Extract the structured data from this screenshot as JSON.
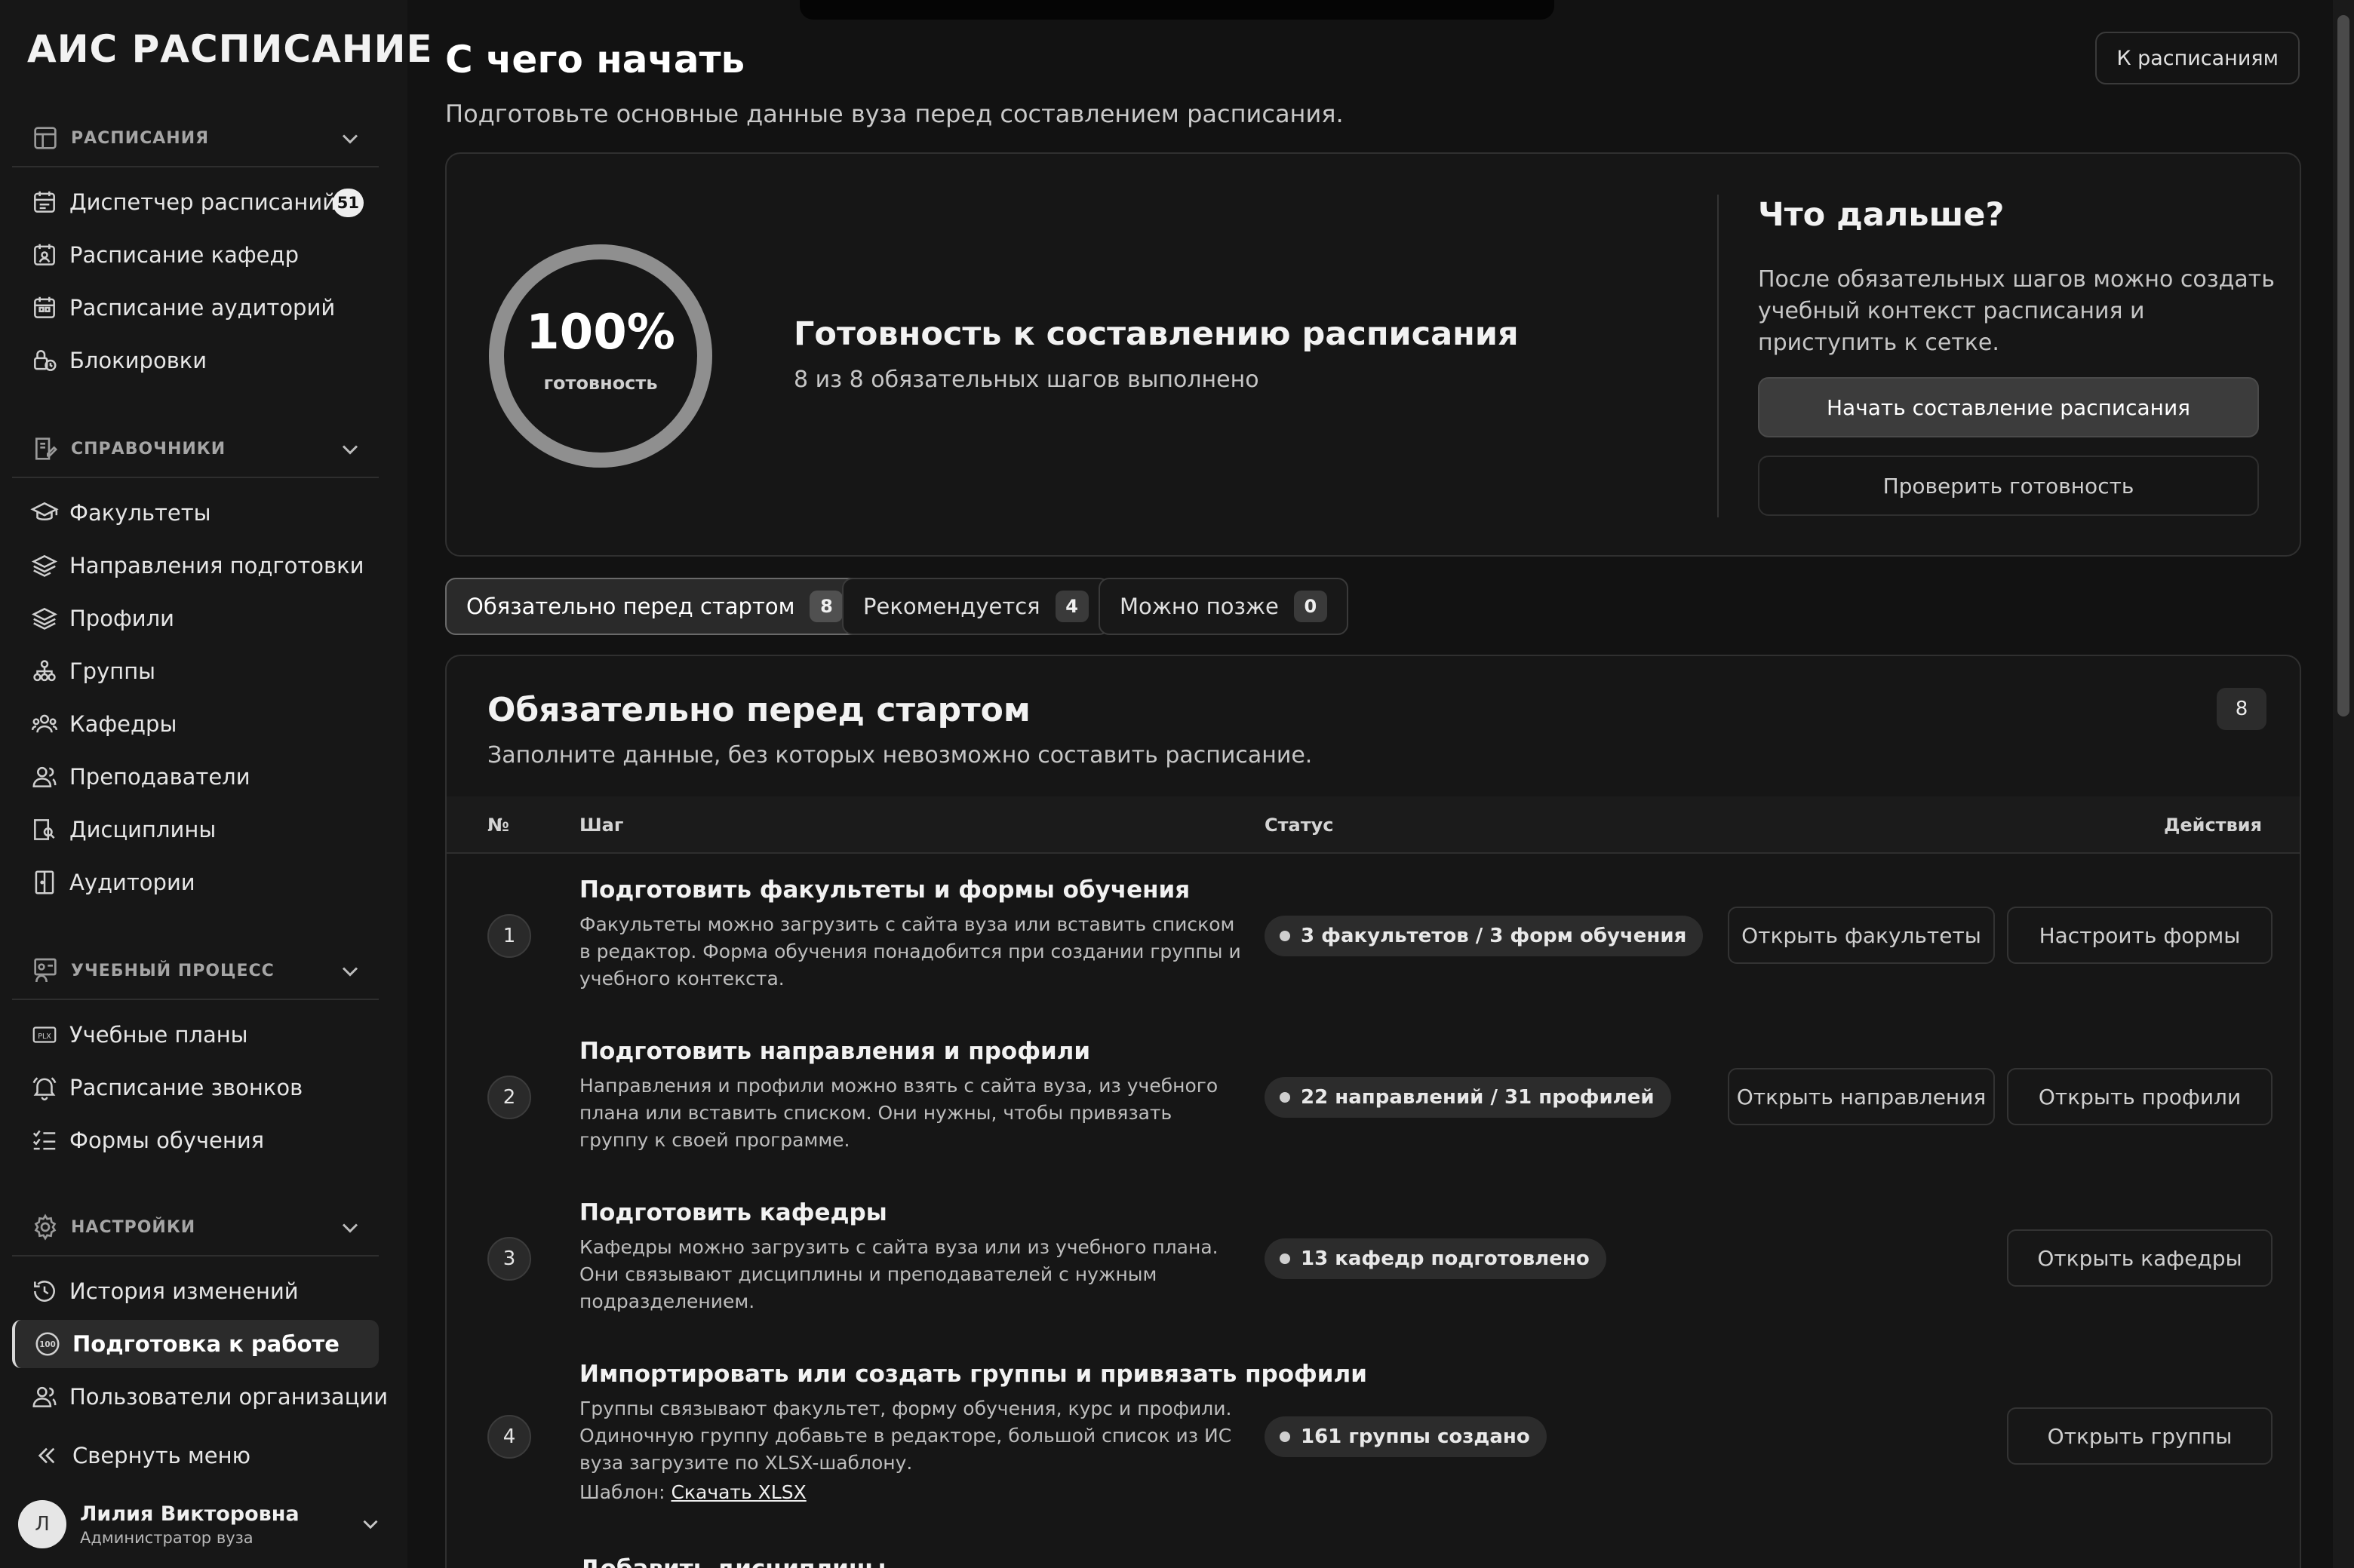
{
  "app": {
    "title": "АИС РАСПИСАНИЕ"
  },
  "sidebar": {
    "sections": [
      {
        "label": "РАСПИСАНИЯ",
        "icon": "layout-icon",
        "items": [
          {
            "label": "Диспетчер расписаний",
            "icon": "calendar-icon",
            "badge": "51"
          },
          {
            "label": "Расписание кафедр",
            "icon": "department-schedule-icon"
          },
          {
            "label": "Расписание аудиторий",
            "icon": "room-schedule-icon"
          },
          {
            "label": "Блокировки",
            "icon": "lock-clock-icon"
          }
        ]
      },
      {
        "label": "СПРАВОЧНИКИ",
        "icon": "edit-book-icon",
        "items": [
          {
            "label": "Факультеты",
            "icon": "graduation-cap-icon"
          },
          {
            "label": "Направления подготовки",
            "icon": "layers-cog-icon"
          },
          {
            "label": "Профили",
            "icon": "layers-icon"
          },
          {
            "label": "Группы",
            "icon": "hierarchy-icon"
          },
          {
            "label": "Кафедры",
            "icon": "people-group-icon"
          },
          {
            "label": "Преподаватели",
            "icon": "users-icon"
          },
          {
            "label": "Дисциплины",
            "icon": "book-search-icon"
          },
          {
            "label": "Аудитории",
            "icon": "door-icon"
          }
        ]
      },
      {
        "label": "УЧЕБНЫЙ ПРОЦЕСС",
        "icon": "teacher-board-icon",
        "items": [
          {
            "label": "Учебные планы",
            "icon": "plx-file-icon"
          },
          {
            "label": "Расписание звонков",
            "icon": "bell-icon"
          },
          {
            "label": "Формы обучения",
            "icon": "checklist-icon"
          }
        ]
      },
      {
        "label": "НАСТРОЙКИ",
        "icon": "gear-icon",
        "items": [
          {
            "label": "История изменений",
            "icon": "history-icon"
          },
          {
            "label": "Подготовка к работе",
            "icon": "readiness-100-icon",
            "active": true
          },
          {
            "label": "Пользователи организации",
            "icon": "users-icon"
          }
        ]
      }
    ],
    "collapse_label": "Свернуть меню",
    "user": {
      "initial": "Л",
      "name": "Лилия Викторовна",
      "role": "Администратор вуза"
    }
  },
  "header": {
    "title": "С чего начать",
    "subtitle": "Подготовьте основные данные вуза перед составлением расписания.",
    "to_schedules_label": "К расписаниям"
  },
  "readiness": {
    "percent_label": "100%",
    "percent_value": 100,
    "caption": "готовность",
    "title": "Готовность к составлению расписания",
    "subtitle": "8 из 8 обязательных шагов выполнено"
  },
  "next": {
    "title": "Что дальше?",
    "text": "После обязательных шагов можно создать учебный контекст расписания и приступить к сетке.",
    "primary_label": "Начать составление расписания",
    "secondary_label": "Проверить готовность"
  },
  "filter_tabs": [
    {
      "label": "Обязательно перед стартом",
      "count": "8",
      "active": true
    },
    {
      "label": "Рекомендуется",
      "count": "4"
    },
    {
      "label": "Можно позже",
      "count": "0"
    }
  ],
  "panel": {
    "title": "Обязательно перед стартом",
    "subtitle": "Заполните данные, без которых невозможно составить расписание.",
    "count": "8",
    "columns": {
      "num": "№",
      "step": "Шаг",
      "status": "Статус",
      "actions": "Действия"
    },
    "rows": [
      {
        "num": "1",
        "title": "Подготовить факультеты и формы обучения",
        "desc": "Факультеты можно загрузить с сайта вуза или вставить списком в редактор. Форма обучения понадобится при создании группы и учебного контекста.",
        "status": "3 факультетов / 3 форм обучения",
        "actions": [
          "Открыть факультеты",
          "Настроить формы"
        ]
      },
      {
        "num": "2",
        "title": "Подготовить направления и профили",
        "desc": "Направления и профили можно взять с сайта вуза, из учебного плана или вставить списком. Они нужны, чтобы привязать группу к своей программе.",
        "status": "22 направлений / 31 профилей",
        "actions": [
          "Открыть направления",
          "Открыть профили"
        ]
      },
      {
        "num": "3",
        "title": "Подготовить кафедры",
        "desc": "Кафедры можно загрузить с сайта вуза или из учебного плана. Они связывают дисциплины и преподавателей с нужным подразделением.",
        "status": "13 кафедр подготовлено",
        "actions": [
          "Открыть кафедры"
        ]
      },
      {
        "num": "4",
        "title": "Импортировать или создать группы и привязать профили",
        "desc": "Группы связывают факультет, форму обучения, курс и профили. Одиночную группу добавьте в редакторе, большой список из ИС вуза загрузите по XLSX-шаблону.",
        "template_label": "Шаблон:",
        "template_link": "Скачать XLSX",
        "status": "161 группы создано",
        "actions": [
          "Открыть группы"
        ]
      }
    ],
    "next_row_title": "Добавить дисциплины"
  }
}
